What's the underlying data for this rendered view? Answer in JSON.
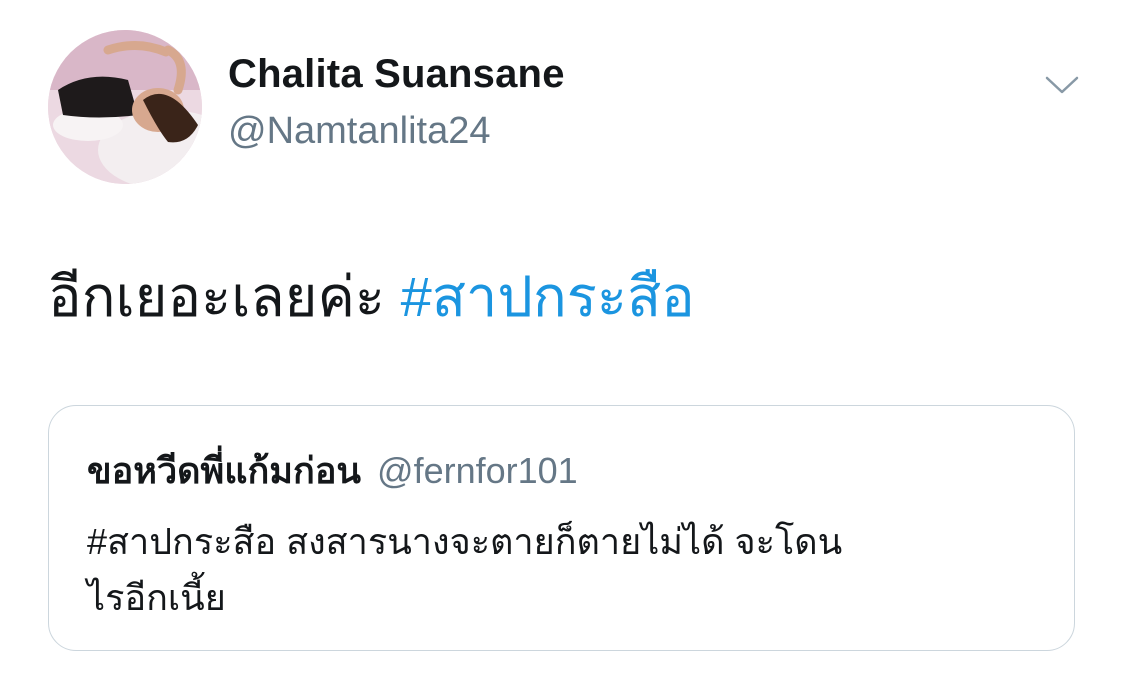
{
  "author": {
    "display_name": "Chalita Suansane",
    "handle": "@Namtanlita24"
  },
  "tweet": {
    "text": "อีกเยอะเลยค่ะ ",
    "hashtag": "#สาปกระสือ"
  },
  "quoted_tweet": {
    "display_name": "ขอหวีดพี่แก้มก่อน",
    "handle": "@fernfor101",
    "line1": "#สาปกระสือ สงสารนางจะตายก็ตายไม่ได้ จะโดน",
    "line2": "ไรอีกเนี้ย"
  },
  "icons": {
    "menu": "chevron-down-icon"
  },
  "colors": {
    "text": "#14171a",
    "secondary": "#657786",
    "link": "#1b95e0",
    "border": "#ccd6dd"
  }
}
